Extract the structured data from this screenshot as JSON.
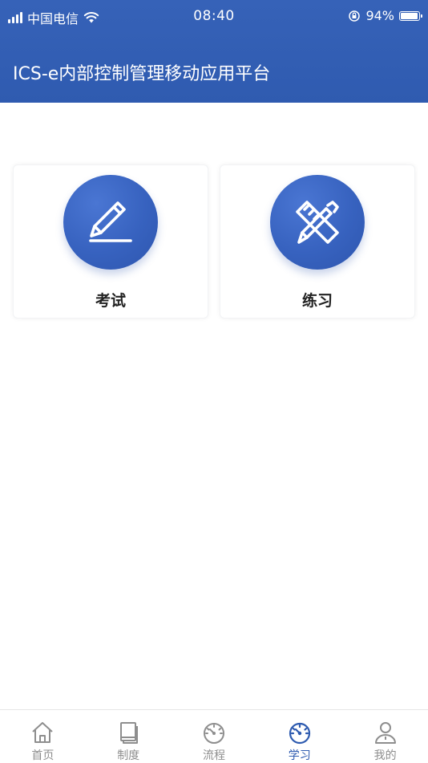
{
  "status_bar": {
    "carrier": "中国电信",
    "time": "08:40",
    "battery_percent": "94%",
    "battery_level": 0.94
  },
  "header": {
    "title": "ICS-e内部控制管理移动应用平台"
  },
  "cards": [
    {
      "label": "考试",
      "icon": "pencil-icon"
    },
    {
      "label": "练习",
      "icon": "pencil-ruler-icon"
    }
  ],
  "tabbar": {
    "items": [
      {
        "label": "首页",
        "icon": "home-icon",
        "active": false
      },
      {
        "label": "制度",
        "icon": "book-icon",
        "active": false
      },
      {
        "label": "流程",
        "icon": "gauge-icon",
        "active": false
      },
      {
        "label": "学习",
        "icon": "compass-icon",
        "active": true
      },
      {
        "label": "我的",
        "icon": "user-icon",
        "active": false
      }
    ]
  },
  "colors": {
    "primary": "#2f5bb0",
    "tab_inactive": "#8e8e8e",
    "card_circle": "#3762bf"
  }
}
